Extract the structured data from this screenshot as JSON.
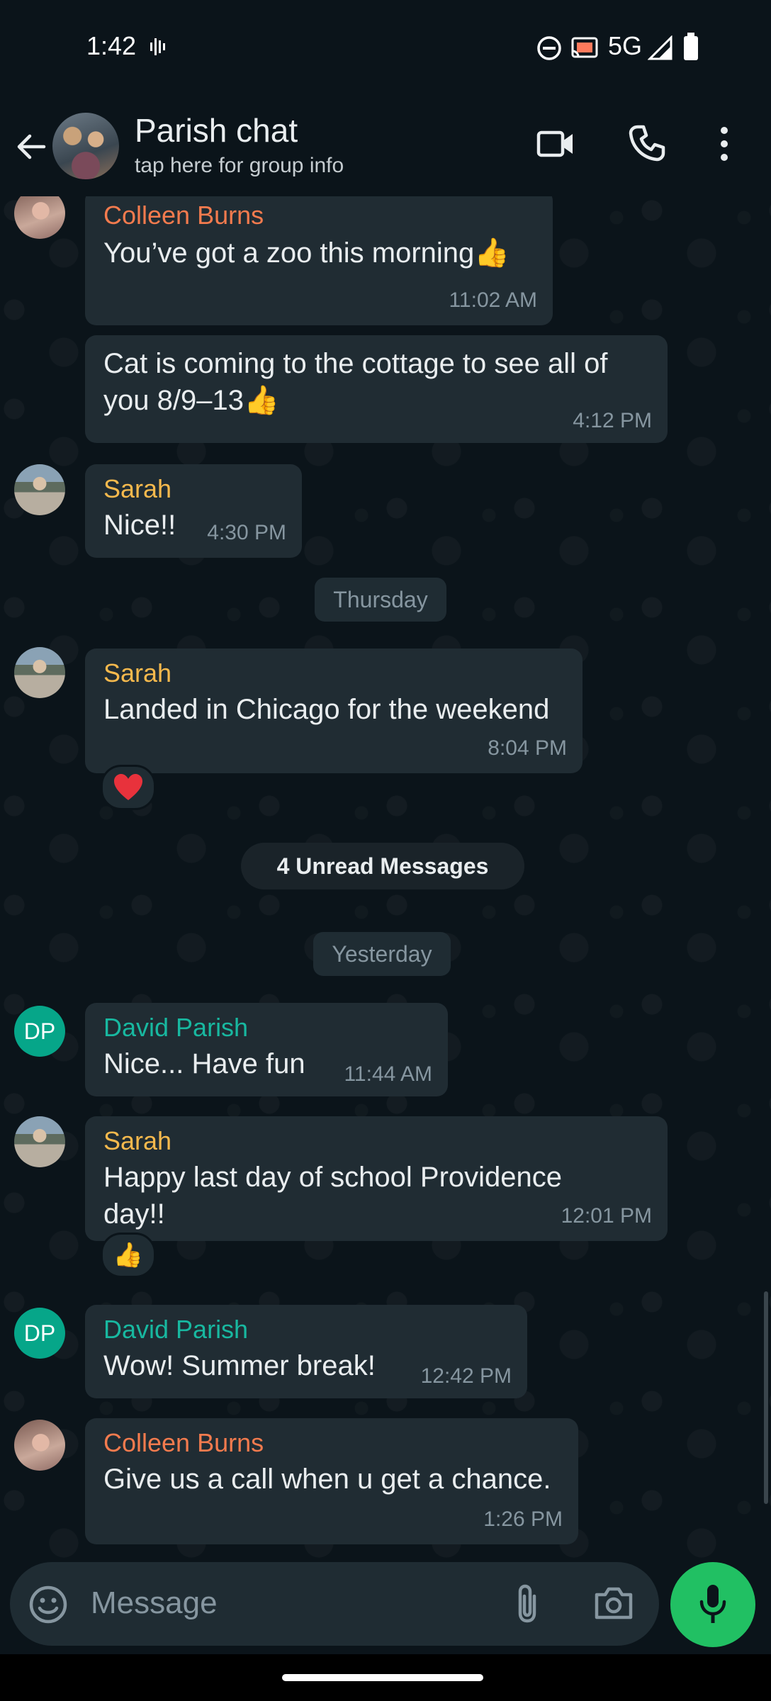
{
  "status_bar": {
    "time": "1:42",
    "network": "5G"
  },
  "header": {
    "title": "Parish chat",
    "subtitle": "tap here for group info"
  },
  "colors": {
    "colleen": "#f47b4e",
    "sarah": "#f6b94d",
    "david": "#18b8a0",
    "accent_green": "#21c063",
    "bubble": "#202c33"
  },
  "messages": [
    {
      "sender": "Colleen Burns",
      "text": "You’ve got a zoo this morning",
      "emoji": "thumbs-up",
      "time": "11:02 AM"
    },
    {
      "sender": "",
      "text_line1": "Cat is coming to the cottage to see all of",
      "text_line2": "you 8/9–13",
      "emoji": "thumbs-up",
      "time": "4:12 PM"
    },
    {
      "sender": "Sarah",
      "text": "Nice!!",
      "time": "4:30 PM"
    },
    {
      "sender": "Sarah",
      "text": "Landed in Chicago for the weekend",
      "time": "8:04 PM",
      "reaction": "red-heart"
    },
    {
      "sender": "David Parish",
      "initials": "DP",
      "text": "Nice... Have fun",
      "time": "11:44 AM"
    },
    {
      "sender": "Sarah",
      "text_line1": "Happy last day of school Providence",
      "text_line2": "day!!",
      "time": "12:01 PM",
      "reaction": "thumbs-up"
    },
    {
      "sender": "David Parish",
      "initials": "DP",
      "text": "Wow!  Summer break!",
      "time": "12:42 PM"
    },
    {
      "sender": "Colleen Burns",
      "text": "Give us a call when u get a chance.",
      "time": "1:26 PM"
    }
  ],
  "dividers": {
    "thursday": "Thursday",
    "unread": "4 Unread Messages",
    "yesterday": "Yesterday"
  },
  "composer": {
    "placeholder": "Message"
  },
  "icons": [
    "back-arrow",
    "video-call",
    "voice-call",
    "more-vert",
    "emoji",
    "attach-paperclip",
    "camera",
    "microphone"
  ]
}
